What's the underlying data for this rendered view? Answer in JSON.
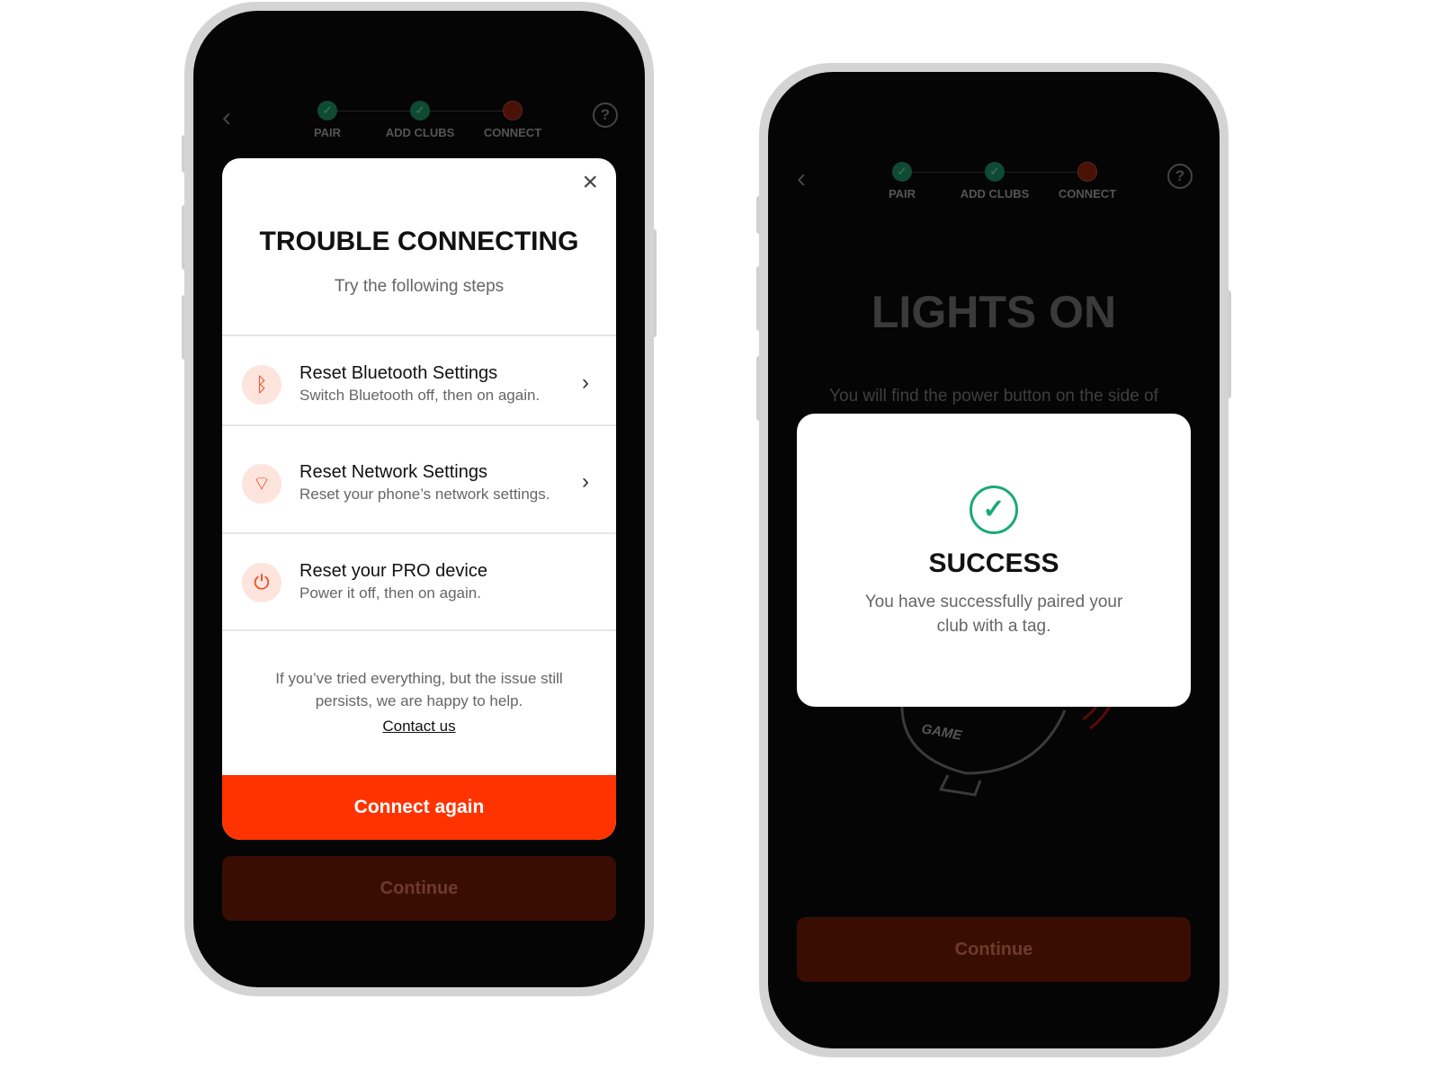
{
  "stepper": {
    "steps": [
      {
        "label": "PAIR",
        "state": "done"
      },
      {
        "label": "ADD CLUBS",
        "state": "done"
      },
      {
        "label": "CONNECT",
        "state": "current"
      }
    ],
    "done_color": "#0f4a34",
    "current_color": "#4a1106"
  },
  "left": {
    "modal": {
      "title": "TROUBLE CONNECTING",
      "subtitle": "Try the following steps",
      "items": [
        {
          "icon": "bluetooth-icon",
          "title": "Reset Bluetooth Settings",
          "subtitle": "Switch Bluetooth off, then on again."
        },
        {
          "icon": "wifi-icon",
          "title": "Reset Network Settings",
          "subtitle": "Reset your phone’s network settings."
        },
        {
          "icon": "power-icon",
          "title": "Reset your PRO device",
          "subtitle": "Power it off, then on again."
        }
      ],
      "help_text": "If you’ve tried everything, but the issue still persists, we are happy to help.",
      "contact_link": "Contact us",
      "primary_button": "Connect again"
    },
    "continue_button": "Continue"
  },
  "right": {
    "heading": "LIGHTS ON",
    "body": "You will find the power button on the side of",
    "device_label": "GAME",
    "modal": {
      "title": "SUCCESS",
      "message": "You have successfully paired your club with a tag."
    },
    "continue_button": "Continue"
  },
  "accent_color": "#ff3300",
  "success_color": "#1aaa77"
}
